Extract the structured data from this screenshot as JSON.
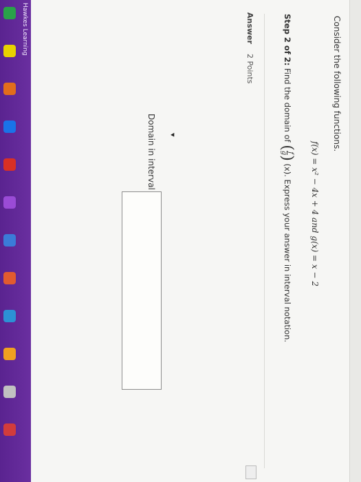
{
  "problem": {
    "intro": "Consider the following functions.",
    "formula": "f(x) = x² − 4x + 4 and g(x) = x − 2",
    "step_label": "Step 2 of 2:",
    "step_text_a": "Find the domain of",
    "step_text_b": "(x). Express your answer in interval notation.",
    "frac_num": "f",
    "frac_den": "g"
  },
  "answer": {
    "label": "Answer",
    "points": "2 Points",
    "field_label": "Domain in interval notation:",
    "value": ""
  },
  "dock": {
    "label": "Hawkes Learning",
    "colors": [
      "#2aa14a",
      "#e8d100",
      "#e26d1b",
      "#1a73e8",
      "#d93025",
      "#9a4bd6",
      "#3b7bd8",
      "#e25b2f",
      "#2c91d5",
      "#f0a020",
      "#c1c1c1",
      "#d23c3c"
    ]
  }
}
